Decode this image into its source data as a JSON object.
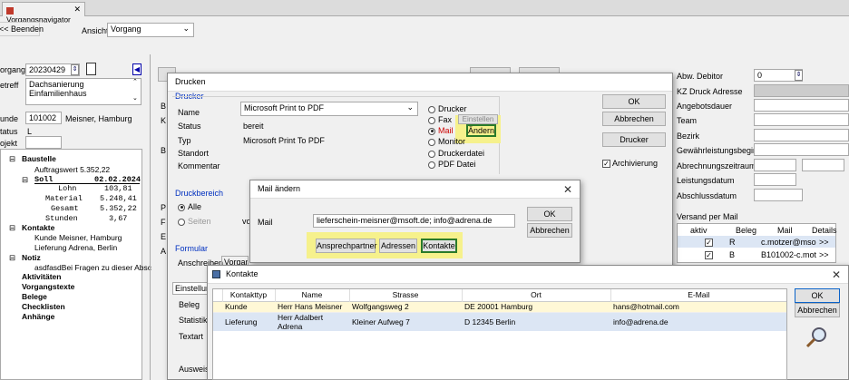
{
  "window": {
    "title": "Vorgangsnavigator",
    "close": "✕"
  },
  "toolbar": {
    "back": "<< Beenden",
    "view_label": "Ansicht",
    "view_value": "Vorgang"
  },
  "left": {
    "vorgang_label": "organg",
    "vorgang_value": "20230429",
    "betreff_label": "etreff",
    "betreff_value": "Dachsanierung Einfamilienhaus",
    "kunde_label": "unde",
    "kunde_no": "101002",
    "kunde_name": "Meisner, Hamburg",
    "status_label": "tatus",
    "status_value": "L",
    "projekt_label": "ojekt",
    "tree": {
      "baustelle": "Baustelle",
      "auftragswert": "Auftragswert 5.352,22",
      "soll": "Soll",
      "soll_date": "02.02.2024",
      "lohn": "Lohn",
      "lohn_v": "103,81",
      "material": "Material",
      "material_v": "5.248,41",
      "gesamt": "Gesamt",
      "gesamt_v": "5.352,22",
      "stunden": "Stunden",
      "stunden_v": "3,67",
      "kontakte": "Kontakte",
      "kunde_line": "Kunde  Meisner, Hamburg",
      "lieferung_line": "Lieferung  Adrena, Berlin",
      "notiz": "Notiz",
      "notiz_text": "asdfasdBei Fragen zu dieser Absc",
      "aktivitaeten": "Aktivitäten",
      "vorgangstexte": "Vorgangstexte",
      "belege": "Belege",
      "checklisten": "Checklisten",
      "anhaenge": "Anhänge"
    }
  },
  "bg": {
    "b1": "B",
    "k": "K",
    "b2": "B",
    "p": "P",
    "f": "F",
    "e": "E",
    "a": "A"
  },
  "right": {
    "abw_debitor": "Abw. Debitor",
    "abw_value": "0",
    "kz_druck": "KZ Druck Adresse",
    "angebotsdauer": "Angebotsdauer",
    "team": "Team",
    "bezirk": "Bezirk",
    "gewaehr": "Gewährleistungsbeginn",
    "abrechnung": "Abrechnungszeitraum",
    "leistungsdatum": "Leistungsdatum",
    "abschlussdatum": "Abschlussdatum",
    "versand": "Versand per Mail",
    "table_headers": [
      "aktiv",
      "Beleg",
      "Mail",
      "Details"
    ],
    "table_rows": [
      {
        "beleg": "R",
        "mail": "c.motzer@mso",
        "details": ">>"
      },
      {
        "beleg": "B",
        "mail": "B101002-c.mot",
        "details": ">>"
      }
    ]
  },
  "drucken": {
    "title": "Drucken",
    "group": "Drucker",
    "name_label": "Name",
    "name_value": "Microsoft Print to PDF",
    "status_label": "Status",
    "status_value": "bereit",
    "typ_label": "Typ",
    "typ_value": "Microsoft Print To PDF",
    "standort_label": "Standort",
    "kommentar_label": "Kommentar",
    "options": [
      "Drucker",
      "Fax",
      "Mail",
      "Monitor",
      "Druckerdatei",
      "PDF Datei"
    ],
    "einstellen": "Einstellen",
    "aendern": "Ändern",
    "ok": "OK",
    "abbrechen": "Abbrechen",
    "drucker_btn": "Drucker",
    "archivierung": "Archivierung",
    "bereich_group": "Druckbereich",
    "alle": "Alle",
    "seiten": "Seiten",
    "vo": "vo",
    "formular_group": "Formular",
    "anschreiben": "Anschreiben",
    "vorgang_tab": "Vorgang",
    "einstellung": "Einstellun",
    "beleg": "Beleg",
    "statistik": "Statistik",
    "textart": "Textart",
    "ausweis": "Ausweis"
  },
  "mail": {
    "title": "Mail ändern",
    "label": "Mail",
    "value": "lieferschein-meisner@msoft.de; info@adrena.de",
    "ok": "OK",
    "abbrechen": "Abbrechen",
    "ansprechpartner": "Ansprechpartner",
    "adressen": "Adressen",
    "kontakte": "Kontakte"
  },
  "kontakte": {
    "title": "Kontakte",
    "headers": [
      "Kontakttyp",
      "Name",
      "Strasse",
      "Ort",
      "E-Mail"
    ],
    "rows": [
      {
        "typ": "Kunde",
        "name": "Herr Hans Meisner",
        "strasse": "Wolfgangsweg 2",
        "ort": "DE 20001 Hamburg",
        "email": "hans@hotmail.com"
      },
      {
        "typ": "Lieferung",
        "name": "Herr Adalbert Adrena",
        "strasse": "Kleiner Aufweg 7",
        "ort": "D 12345 Berlin",
        "email": "info@adrena.de"
      }
    ],
    "ok": "OK",
    "abbrechen": "Abbrechen"
  },
  "colors": {
    "highlight": "#f6f18c",
    "group_blue": "#0030c0",
    "row_selected": "#dce6f4",
    "row_yellow": "#fff8d6"
  }
}
